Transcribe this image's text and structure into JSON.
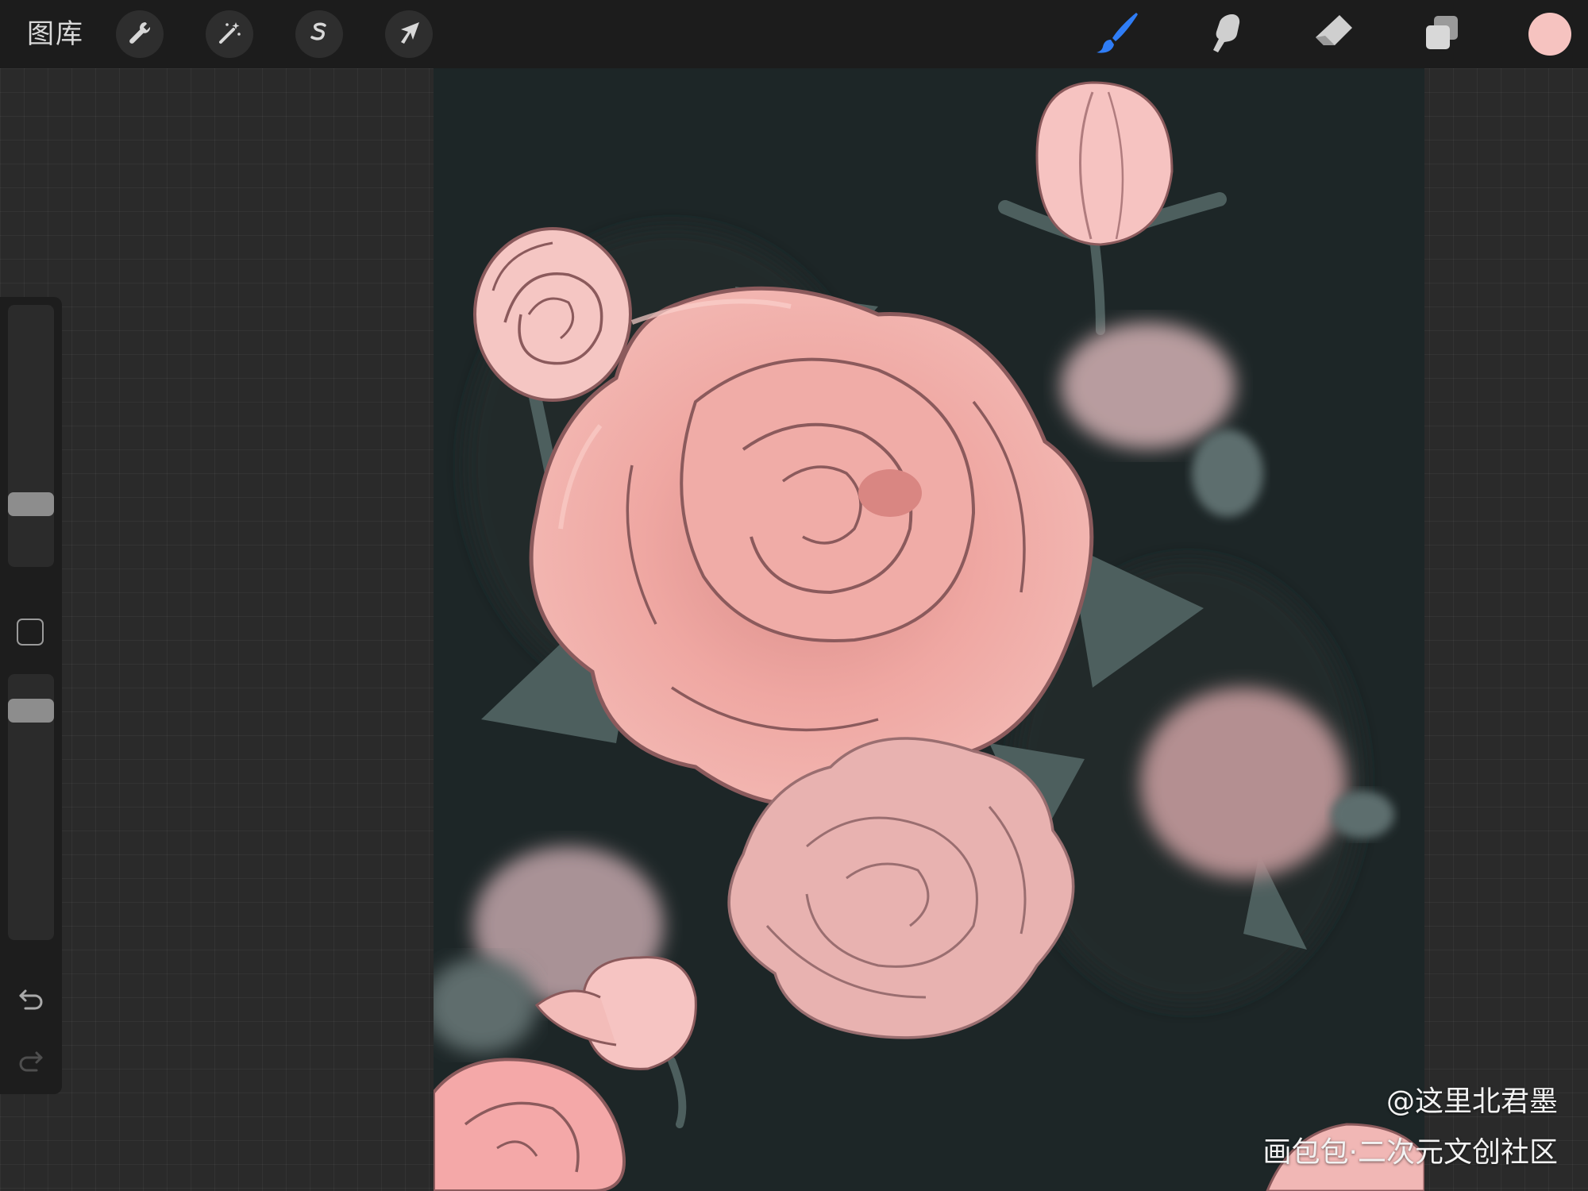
{
  "toolbar": {
    "gallery_label": "图库",
    "left_tools": [
      {
        "name": "actions",
        "icon": "wrench-icon"
      },
      {
        "name": "adjustments",
        "icon": "magic-wand-icon"
      },
      {
        "name": "selection",
        "icon": "selection-s-icon"
      },
      {
        "name": "transform",
        "icon": "arrow-cursor-icon"
      }
    ],
    "right_tools": [
      {
        "name": "brush",
        "icon": "brush-icon",
        "active": true
      },
      {
        "name": "smudge",
        "icon": "smudge-finger-icon",
        "active": false
      },
      {
        "name": "eraser",
        "icon": "eraser-icon",
        "active": false
      },
      {
        "name": "layers",
        "icon": "layers-icon",
        "active": false
      }
    ],
    "current_color": "#f6c3c0",
    "active_color": "#2f7df6"
  },
  "sidebar": {
    "brush_size_level": 0.27,
    "opacity_level": 0.8,
    "icons": [
      "modify-square-icon",
      "undo-icon",
      "redo-icon"
    ]
  },
  "canvas": {
    "background": "#1c2526",
    "subject": "pink roses illustration"
  },
  "watermark": {
    "author": "@这里北君墨",
    "site": "画包包·二次元文创社区"
  }
}
